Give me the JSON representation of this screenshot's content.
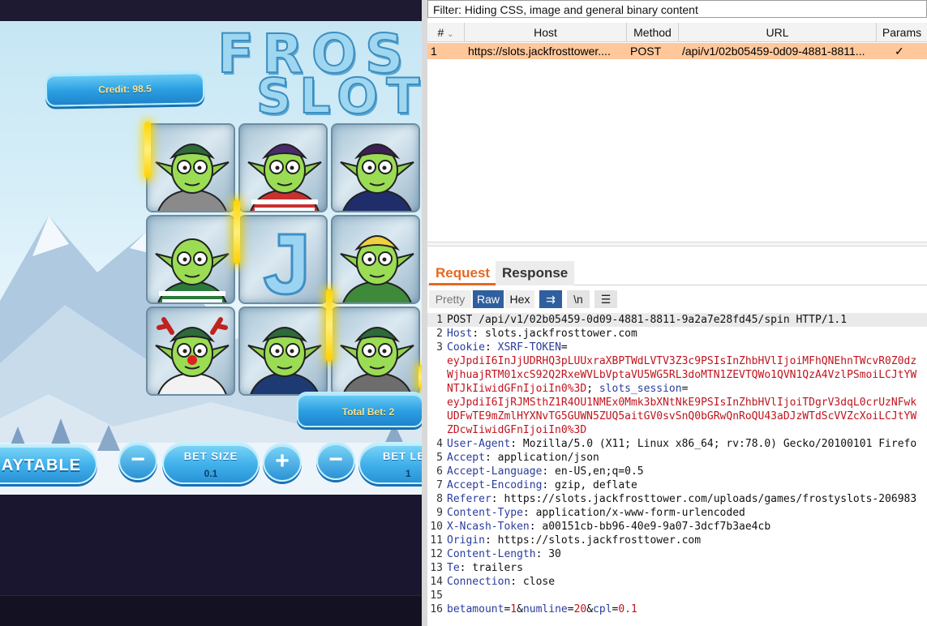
{
  "game": {
    "title_line1": "FROS",
    "title_line2": "SLOT",
    "credit_label": "Credit: 98.5",
    "total_bet_label": "Total Bet: 2",
    "paytable_label": "AYTABLE",
    "bet_size_label": "BET SIZE",
    "bet_size_value": "0.1",
    "bet_level_label": "BET LEV",
    "bet_level_value": "1",
    "minus_glyph": "−",
    "plus_glyph": "+",
    "reels": [
      [
        "goblin-bun-glasses",
        "goblin-purple-mohawk-striped",
        "goblin-purple-afro-sweater"
      ],
      [
        "goblin-bald-striped-sweater",
        "ice-letter-j",
        "goblin-blonde-lights"
      ],
      [
        "goblin-reindeer-antlers",
        "goblin-mohawk-sweater",
        "goblin-bun-glasses-2"
      ]
    ],
    "win_color": "#ffd400"
  },
  "proxy": {
    "filter_text": "Filter: Hiding CSS, image and general binary content",
    "table": {
      "columns": [
        "#",
        "Host",
        "Method",
        "URL",
        "Params"
      ],
      "sort_icon": "chevron-down-icon",
      "rows": [
        {
          "num": "1",
          "host": "https://slots.jackfrosttower....",
          "method": "POST",
          "url": "/api/v1/02b05459-0d09-4881-8811...",
          "params": "✓"
        }
      ]
    },
    "tabs": [
      "Request",
      "Response"
    ],
    "view_buttons": {
      "pretty": "Pretty",
      "raw": "Raw",
      "hex": "Hex",
      "wrap": "⇉",
      "newline": "\\n",
      "menu": "☰"
    },
    "request_lines": [
      {
        "n": "1",
        "parts": [
          {
            "t": "POST /api/v1/02b05459-0d09-4881-8811-9a2a7e28fd45/spin HTTP/1.1",
            "c": ""
          }
        ]
      },
      {
        "n": "2",
        "parts": [
          {
            "t": "Host",
            "c": "hname"
          },
          {
            "t": ": slots.jackfrosttower.com",
            "c": ""
          }
        ]
      },
      {
        "n": "3",
        "parts": [
          {
            "t": "Cookie",
            "c": "hname"
          },
          {
            "t": ": ",
            "c": ""
          },
          {
            "t": "XSRF-TOKEN",
            "c": "blue"
          },
          {
            "t": "=",
            "c": ""
          }
        ]
      },
      {
        "n": "",
        "parts": [
          {
            "t": "eyJpdiI6InJjUDRHQ3pLUUxraXBPTWdLVTV3Z3c9PSIsInZhbHVlIjoiMFhQNEhnTWcvR0Z0dz",
            "c": "red"
          }
        ]
      },
      {
        "n": "",
        "parts": [
          {
            "t": "WjhuajRTM01xcS92Q2RxeWVLbVptaVU5WG5RL3doMTN1ZEVTQWo1QVN1QzA4VzlPSmoiLCJtYW",
            "c": "red"
          }
        ]
      },
      {
        "n": "",
        "parts": [
          {
            "t": "NTJkIiwidGFnIjoiIn0%3D",
            "c": "red"
          },
          {
            "t": "; ",
            "c": ""
          },
          {
            "t": "slots_session",
            "c": "blue"
          },
          {
            "t": "=",
            "c": ""
          }
        ]
      },
      {
        "n": "",
        "parts": [
          {
            "t": "eyJpdiI6IjRJMSthZ1R4OU1NMEx0Mmk3bXNtNkE9PSIsInZhbHVlIjoiTDgrV3dqL0crUzNFwk",
            "c": "red"
          }
        ]
      },
      {
        "n": "",
        "parts": [
          {
            "t": "UDFwTE9mZmlHYXNvTG5GUWN5ZUQ5aitGV0svSnQ0bGRwQnRoQU43aDJzWTdScVVZcXoiLCJtYW",
            "c": "red"
          }
        ]
      },
      {
        "n": "",
        "parts": [
          {
            "t": "ZDcwIiwidGFnIjoiIn0%3D",
            "c": "red"
          }
        ]
      },
      {
        "n": "4",
        "parts": [
          {
            "t": "User-Agent",
            "c": "hname"
          },
          {
            "t": ": Mozilla/5.0 (X11; Linux x86_64; rv:78.0) Gecko/20100101 Firefo",
            "c": ""
          }
        ]
      },
      {
        "n": "5",
        "parts": [
          {
            "t": "Accept",
            "c": "hname"
          },
          {
            "t": ": application/json",
            "c": ""
          }
        ]
      },
      {
        "n": "6",
        "parts": [
          {
            "t": "Accept-Language",
            "c": "hname"
          },
          {
            "t": ": en-US,en;q=0.5",
            "c": ""
          }
        ]
      },
      {
        "n": "7",
        "parts": [
          {
            "t": "Accept-Encoding",
            "c": "hname"
          },
          {
            "t": ": gzip, deflate",
            "c": ""
          }
        ]
      },
      {
        "n": "8",
        "parts": [
          {
            "t": "Referer",
            "c": "hname"
          },
          {
            "t": ": https://slots.jackfrosttower.com/uploads/games/frostyslots-206983",
            "c": ""
          }
        ]
      },
      {
        "n": "9",
        "parts": [
          {
            "t": "Content-Type",
            "c": "hname"
          },
          {
            "t": ": application/x-www-form-urlencoded",
            "c": ""
          }
        ]
      },
      {
        "n": "10",
        "parts": [
          {
            "t": "X-Ncash-Token",
            "c": "hname"
          },
          {
            "t": ": a00151cb-bb96-40e9-9a07-3dcf7b3ae4cb",
            "c": ""
          }
        ]
      },
      {
        "n": "11",
        "parts": [
          {
            "t": "Origin",
            "c": "hname"
          },
          {
            "t": ": https://slots.jackfrosttower.com",
            "c": ""
          }
        ]
      },
      {
        "n": "12",
        "parts": [
          {
            "t": "Content-Length",
            "c": "hname"
          },
          {
            "t": ": 30",
            "c": ""
          }
        ]
      },
      {
        "n": "13",
        "parts": [
          {
            "t": "Te",
            "c": "hname"
          },
          {
            "t": ": trailers",
            "c": ""
          }
        ]
      },
      {
        "n": "14",
        "parts": [
          {
            "t": "Connection",
            "c": "hname"
          },
          {
            "t": ": close",
            "c": ""
          }
        ]
      },
      {
        "n": "15",
        "parts": []
      },
      {
        "n": "16",
        "parts": [
          {
            "t": "betamount",
            "c": "blue"
          },
          {
            "t": "=",
            "c": ""
          },
          {
            "t": "1",
            "c": "red"
          },
          {
            "t": "&",
            "c": ""
          },
          {
            "t": "numline",
            "c": "blue"
          },
          {
            "t": "=",
            "c": ""
          },
          {
            "t": "20",
            "c": "red"
          },
          {
            "t": "&",
            "c": ""
          },
          {
            "t": "cpl",
            "c": "blue"
          },
          {
            "t": "=",
            "c": ""
          },
          {
            "t": "0.1",
            "c": "red"
          }
        ]
      }
    ],
    "accent_color": "#e8671f",
    "selected_row_color": "#ffc79a"
  }
}
